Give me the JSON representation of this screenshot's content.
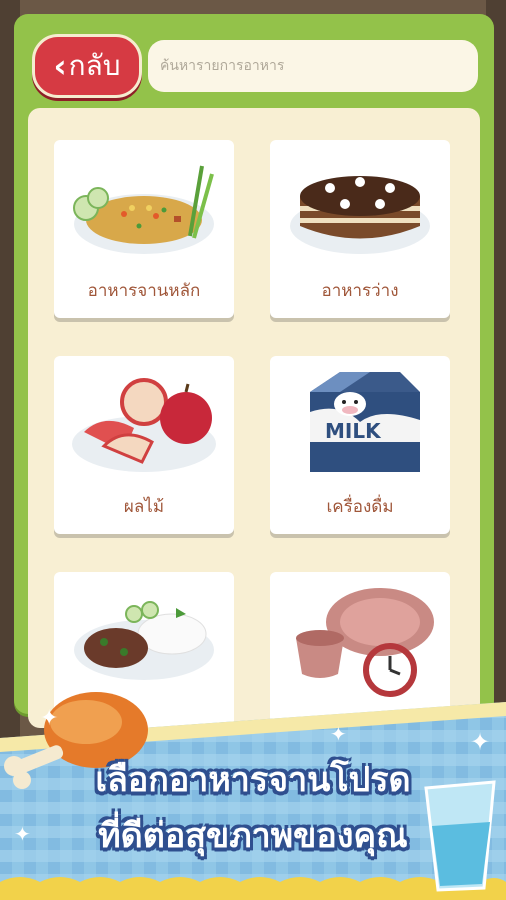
{
  "header": {
    "back_label": "กลับ",
    "search_placeholder": "ค้นหารายการอาหาร"
  },
  "categories": [
    {
      "label": "อาหารจานหลัก",
      "icon": "fried-rice-icon"
    },
    {
      "label": "อาหารว่าง",
      "icon": "cake-icon"
    },
    {
      "label": "ผลไม้",
      "icon": "apple-icon"
    },
    {
      "label": "เครื่องดื่ม",
      "icon": "milk-carton-icon"
    },
    {
      "label": "",
      "icon": "rice-plate-icon"
    },
    {
      "label": "",
      "icon": "history-plate-icon"
    }
  ],
  "banner": {
    "line1": "เลือกอาหารจานโปรด",
    "line2": "ที่ดีต่อสุขภาพของคุณ"
  },
  "colors": {
    "frame": "#93c24a",
    "panel": "#f8efd3",
    "back_button": "#d63a43",
    "label_text": "#a0573a",
    "banner_outline": "#2f4f8f"
  }
}
